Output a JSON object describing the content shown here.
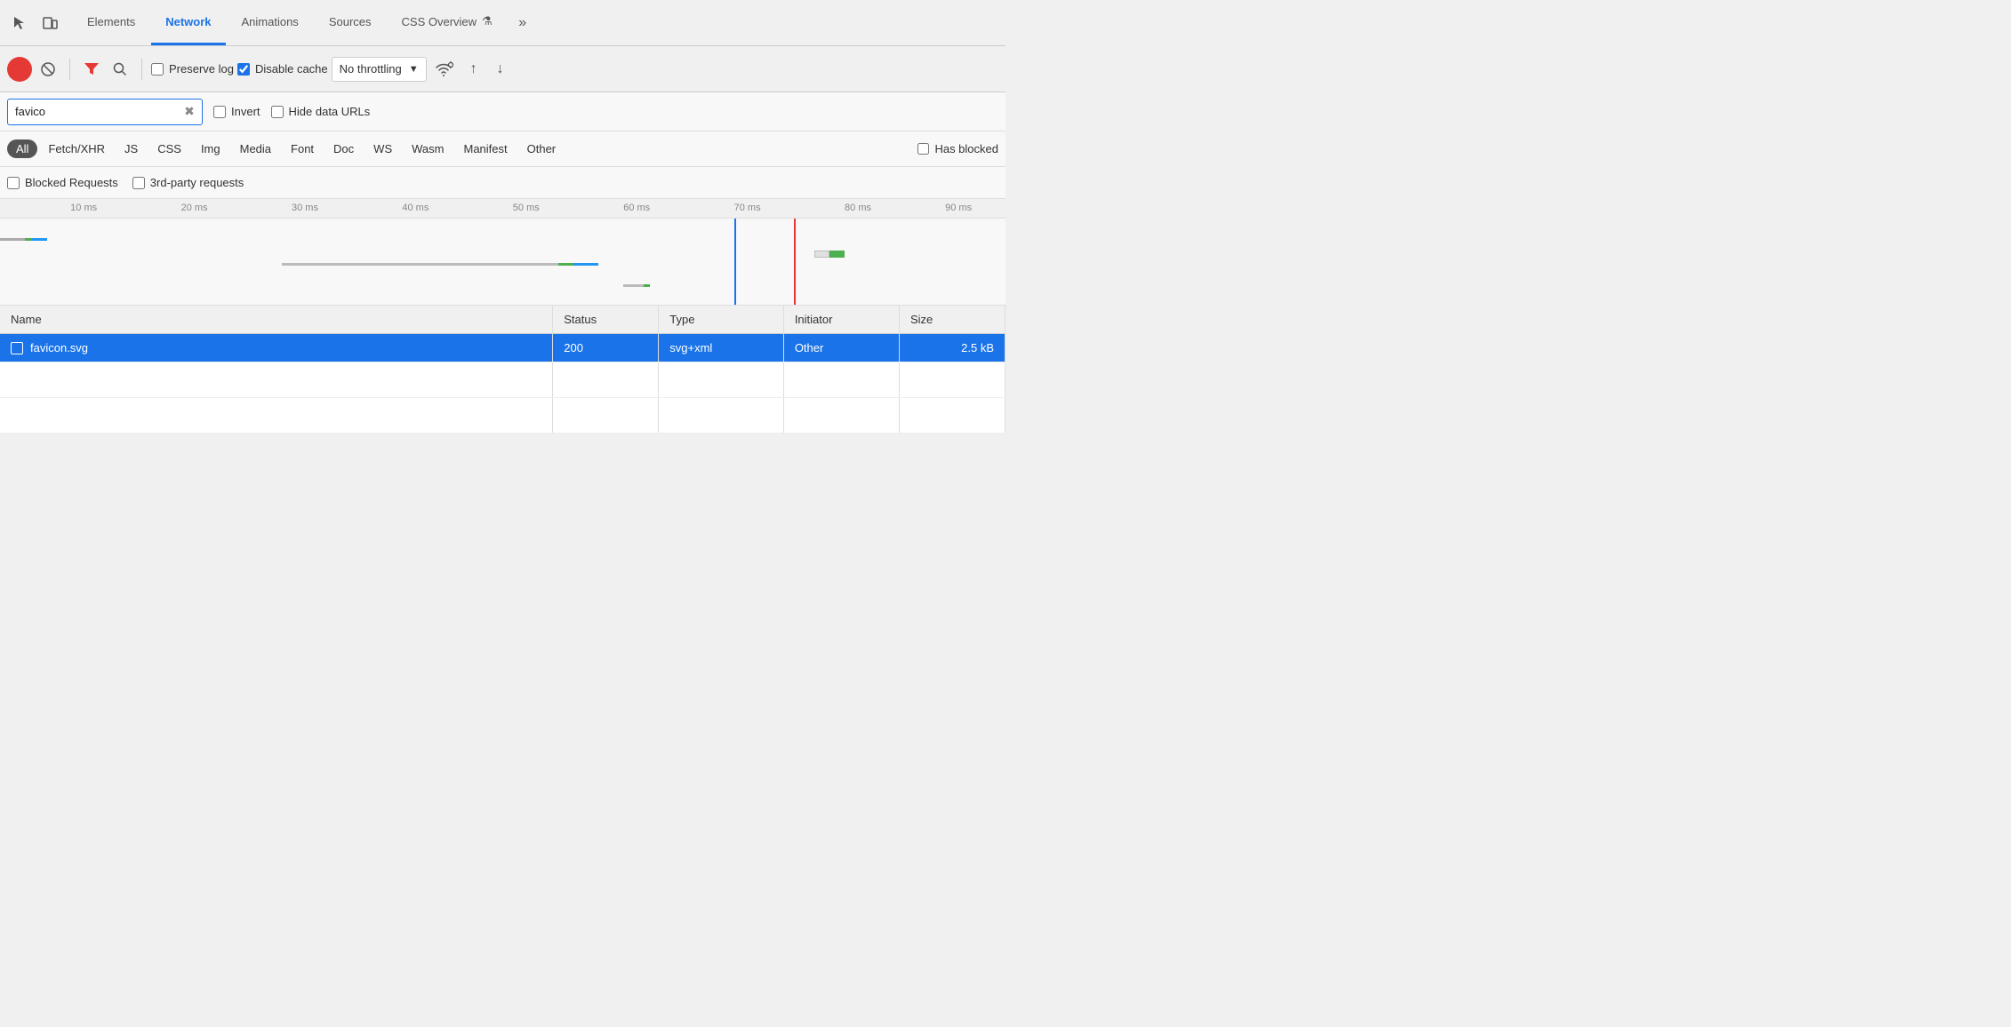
{
  "tabs": {
    "items": [
      {
        "label": "Elements",
        "active": false
      },
      {
        "label": "Network",
        "active": true
      },
      {
        "label": "Animations",
        "active": false
      },
      {
        "label": "Sources",
        "active": false
      },
      {
        "label": "CSS Overview",
        "active": false
      }
    ],
    "more_label": "»"
  },
  "toolbar": {
    "preserve_log_label": "Preserve log",
    "disable_cache_label": "Disable cache",
    "throttle_label": "No throttling",
    "preserve_log_checked": false,
    "disable_cache_checked": true
  },
  "filter": {
    "search_value": "favico",
    "search_placeholder": "Filter",
    "invert_label": "Invert",
    "hide_data_label": "Hide data URLs",
    "invert_checked": false,
    "hide_data_checked": false
  },
  "type_filters": {
    "items": [
      {
        "label": "All",
        "active": true
      },
      {
        "label": "Fetch/XHR",
        "active": false
      },
      {
        "label": "JS",
        "active": false
      },
      {
        "label": "CSS",
        "active": false
      },
      {
        "label": "Img",
        "active": false
      },
      {
        "label": "Media",
        "active": false
      },
      {
        "label": "Font",
        "active": false
      },
      {
        "label": "Doc",
        "active": false
      },
      {
        "label": "WS",
        "active": false
      },
      {
        "label": "Wasm",
        "active": false
      },
      {
        "label": "Manifest",
        "active": false
      },
      {
        "label": "Other",
        "active": false
      }
    ],
    "has_blocked_label": "Has blocked"
  },
  "blocked": {
    "blocked_requests_label": "Blocked Requests",
    "third_party_label": "3rd-party requests",
    "blocked_checked": false,
    "third_party_checked": false
  },
  "ruler": {
    "ticks": [
      {
        "label": "10 ms",
        "left_pct": 8.5
      },
      {
        "label": "20 ms",
        "left_pct": 19.5
      },
      {
        "label": "30 ms",
        "left_pct": 30.5
      },
      {
        "label": "40 ms",
        "left_pct": 41.5
      },
      {
        "label": "50 ms",
        "left_pct": 52.5
      },
      {
        "label": "60 ms",
        "left_pct": 63.5
      },
      {
        "label": "70 ms",
        "left_pct": 74.5
      },
      {
        "label": "80 ms",
        "left_pct": 85.5
      },
      {
        "label": "90 ms",
        "left_pct": 96.5
      }
    ]
  },
  "table": {
    "columns": [
      {
        "label": "Name",
        "key": "name"
      },
      {
        "label": "Status",
        "key": "status"
      },
      {
        "label": "Type",
        "key": "type"
      },
      {
        "label": "Initiator",
        "key": "initiator"
      },
      {
        "label": "Size",
        "key": "size"
      }
    ],
    "rows": [
      {
        "name": "favicon.svg",
        "status": "200",
        "type": "svg+xml",
        "initiator": "Other",
        "size": "2.5 kB",
        "selected": true
      }
    ]
  }
}
